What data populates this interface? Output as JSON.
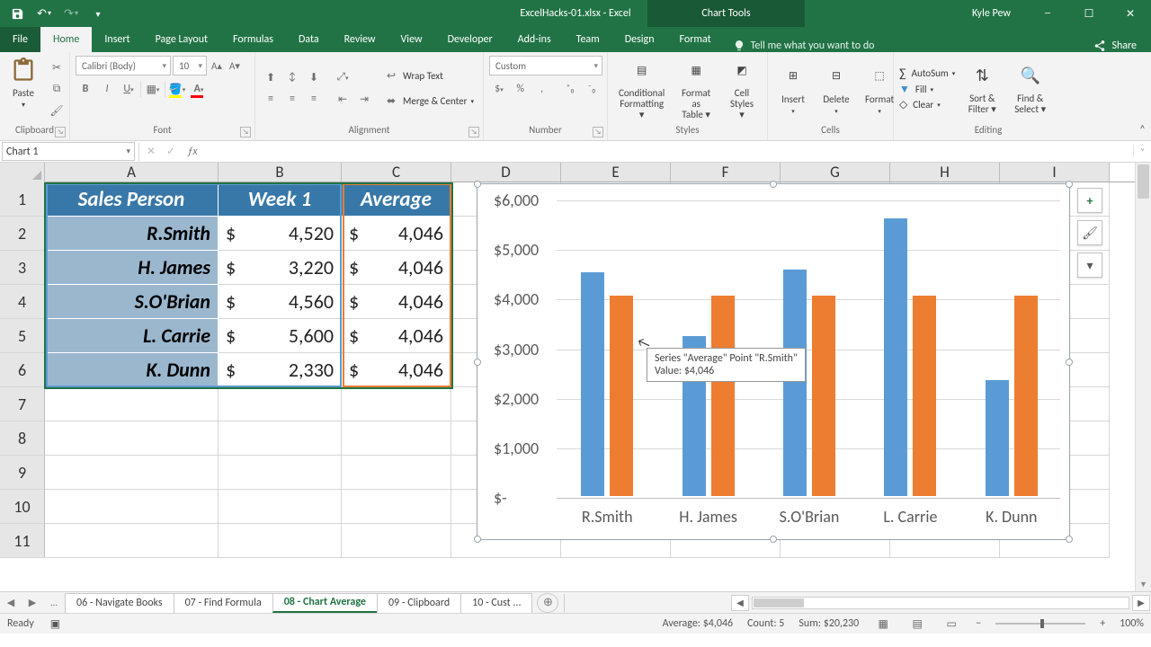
{
  "title_bar": {
    "filename": "ExcelHacks-01.xlsx - Excel",
    "chart_tools": "Chart Tools",
    "user": "Kyle Pew"
  },
  "tabs": {
    "file": "File",
    "items": [
      "Home",
      "Insert",
      "Page Layout",
      "Formulas",
      "Data",
      "Review",
      "View",
      "Developer",
      "Add-ins",
      "Team",
      "Design",
      "Format"
    ],
    "active": "Home",
    "tellme": "Tell me what you want to do",
    "share": "Share"
  },
  "ribbon": {
    "clipboard": {
      "label": "Clipboard",
      "paste": "Paste"
    },
    "font": {
      "label": "Font",
      "name": "Calibri (Body)",
      "size": "10"
    },
    "alignment": {
      "label": "Alignment",
      "wrap": "Wrap Text",
      "merge": "Merge & Center"
    },
    "number": {
      "label": "Number",
      "format": "Custom"
    },
    "styles": {
      "label": "Styles",
      "cond": "Conditional\nFormatting",
      "table": "Format as\nTable",
      "cell": "Cell\nStyles"
    },
    "cells": {
      "label": "Cells",
      "insert": "Insert",
      "delete": "Delete",
      "format": "Format"
    },
    "editing": {
      "label": "Editing",
      "autosum": "AutoSum",
      "fill": "Fill",
      "clear": "Clear",
      "sort": "Sort &\nFilter",
      "find": "Find &\nSelect"
    }
  },
  "name_box": "Chart 1",
  "columns": [
    "A",
    "B",
    "C",
    "D",
    "E",
    "F",
    "G",
    "H",
    "I"
  ],
  "table": {
    "headers": [
      "Sales Person",
      "Week 1",
      "Average"
    ],
    "rows": [
      {
        "name": "R.Smith",
        "week1": "4,520",
        "avg": "4,046"
      },
      {
        "name": "H. James",
        "week1": "3,220",
        "avg": "4,046"
      },
      {
        "name": "S.O'Brian",
        "week1": "4,560",
        "avg": "4,046"
      },
      {
        "name": "L. Carrie",
        "week1": "5,600",
        "avg": "4,046"
      },
      {
        "name": "K. Dunn",
        "week1": "2,330",
        "avg": "4,046"
      }
    ],
    "currency": "$"
  },
  "chart_data": {
    "type": "bar",
    "categories": [
      "R.Smith",
      "H. James",
      "S.O'Brian",
      "L. Carrie",
      "K. Dunn"
    ],
    "series": [
      {
        "name": "Week 1",
        "color": "#5b9bd5",
        "values": [
          4520,
          3220,
          4560,
          5600,
          2330
        ]
      },
      {
        "name": "Average",
        "color": "#ed7d31",
        "values": [
          4046,
          4046,
          4046,
          4046,
          4046
        ]
      }
    ],
    "ylim": [
      0,
      6000
    ],
    "yticks": [
      "$-",
      "$1,000",
      "$2,000",
      "$3,000",
      "$4,000",
      "$5,000",
      "$6,000"
    ],
    "tooltip": {
      "line1": "Series \"Average\" Point \"R.Smith\"",
      "line2": "Value: $4,046"
    }
  },
  "sheet_tabs": {
    "items": [
      "06 - Navigate Books",
      "07 - Find Formula",
      "08 - Chart Average",
      "09 - Clipboard",
      "10 - Cust ..."
    ],
    "active": "08 - Chart Average",
    "ellipsis": "..."
  },
  "status": {
    "ready": "Ready",
    "avg": "Average: $4,046",
    "count": "Count: 5",
    "sum": "Sum: $20,230",
    "zoom": "100%"
  }
}
